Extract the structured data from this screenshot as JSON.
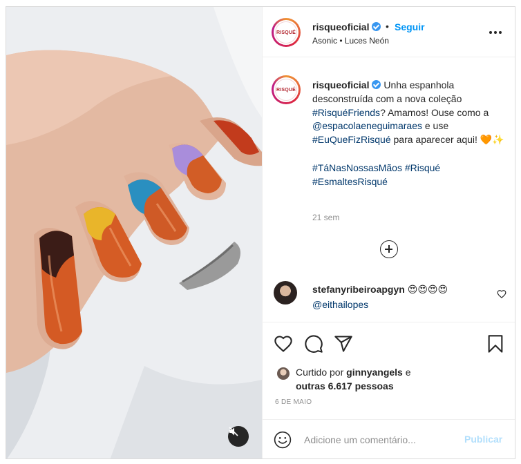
{
  "header": {
    "avatar_text": "RISQUÉ",
    "username": "risqueoficial",
    "separator": "•",
    "follow_label": "Seguir",
    "subtitle": "Asonic • Luces Neón"
  },
  "caption": {
    "username": "risqueoficial",
    "text_1": " Unha espanhola desconstruída com a nova coleção ",
    "tag_1": "#RisquéFriends",
    "text_2": "? Amamos! Ouse como a ",
    "mention": "@espacolaeneguimaraes",
    "text_3": " e use ",
    "tag_2": "#EuQueFizRisqué",
    "text_4": " para aparecer aqui! ",
    "emoji": "🧡✨",
    "tags_line_1": "#TáNasNossasMãos",
    "tags_line_1b": "#Risqué",
    "tags_line_2": "#EsmaltesRisqué",
    "time": "21 sem"
  },
  "comment": {
    "username": "stefanyribeiroapgyn",
    "emoji": "😍😍😍😍",
    "mention": "@eithailopes"
  },
  "likes": {
    "prefix": "Curtido por ",
    "user": "ginnyangels",
    "mid": " e",
    "others": "outras 6.617 pessoas"
  },
  "date": "6 DE MAIO",
  "comment_box": {
    "placeholder": "Adicione um comentário...",
    "publish_label": "Publicar"
  },
  "colors": {
    "link": "#00376b",
    "follow": "#0095f6",
    "publish_disabled": "#b2dffc",
    "verified": "#3897f0"
  }
}
